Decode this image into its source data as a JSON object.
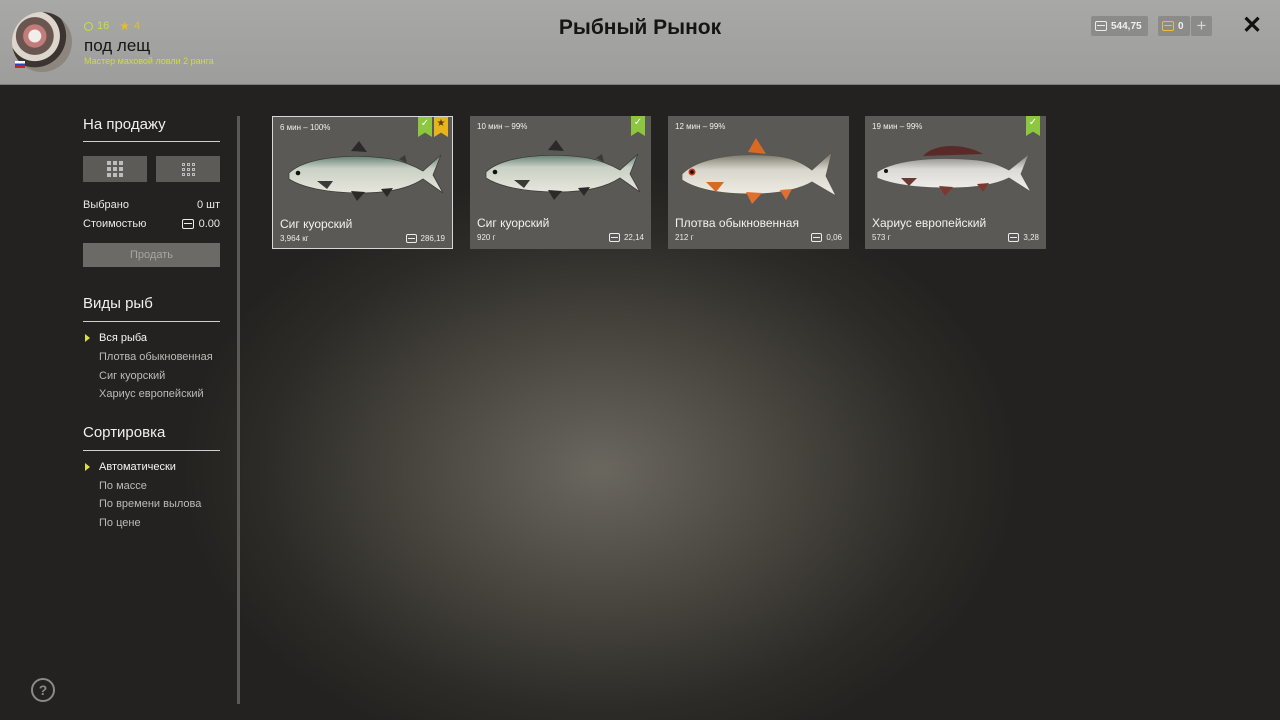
{
  "header": {
    "title": "Рыбный Рынок",
    "player": {
      "name": "под лещ",
      "level": "16",
      "stars": "4",
      "rank_title": "Мастер маховой ловли 2 ранга"
    },
    "silver": "544,75",
    "gold": "0",
    "add_label": "+",
    "close_label": "✕"
  },
  "sidebar": {
    "sale_title": "На продажу",
    "selected_label": "Выбрано",
    "selected_value": "0 шт",
    "cost_label": "Стоимостью",
    "cost_value": "0.00",
    "sell_label": "Продать",
    "species_title": "Виды рыб",
    "species": [
      {
        "label": "Вся рыба",
        "active": true
      },
      {
        "label": "Плотва обыкновенная",
        "active": false
      },
      {
        "label": "Сиг куорский",
        "active": false
      },
      {
        "label": "Хариус европейский",
        "active": false
      }
    ],
    "sort_title": "Сортировка",
    "sort": [
      {
        "label": "Автоматически",
        "active": true
      },
      {
        "label": "По массе",
        "active": false
      },
      {
        "label": "По времени вылова",
        "active": false
      },
      {
        "label": "По цене",
        "active": false
      }
    ]
  },
  "cards": [
    {
      "time": "6 мин – 100%",
      "name": "Сиг куорский",
      "weight": "3,964 кг",
      "price": "286,19",
      "checked": true,
      "starred": true,
      "fish": "whitefish"
    },
    {
      "time": "10 мин – 99%",
      "name": "Сиг куорский",
      "weight": "920 г",
      "price": "22,14",
      "checked": true,
      "starred": false,
      "fish": "whitefish"
    },
    {
      "time": "12 мин – 99%",
      "name": "Плотва обыкновенная",
      "weight": "212 г",
      "price": "0,06",
      "checked": false,
      "starred": false,
      "fish": "roach"
    },
    {
      "time": "19 мин – 99%",
      "name": "Хариус европейский",
      "weight": "573 г",
      "price": "3,28",
      "checked": true,
      "starred": false,
      "fish": "grayling"
    }
  ],
  "help_label": "?"
}
